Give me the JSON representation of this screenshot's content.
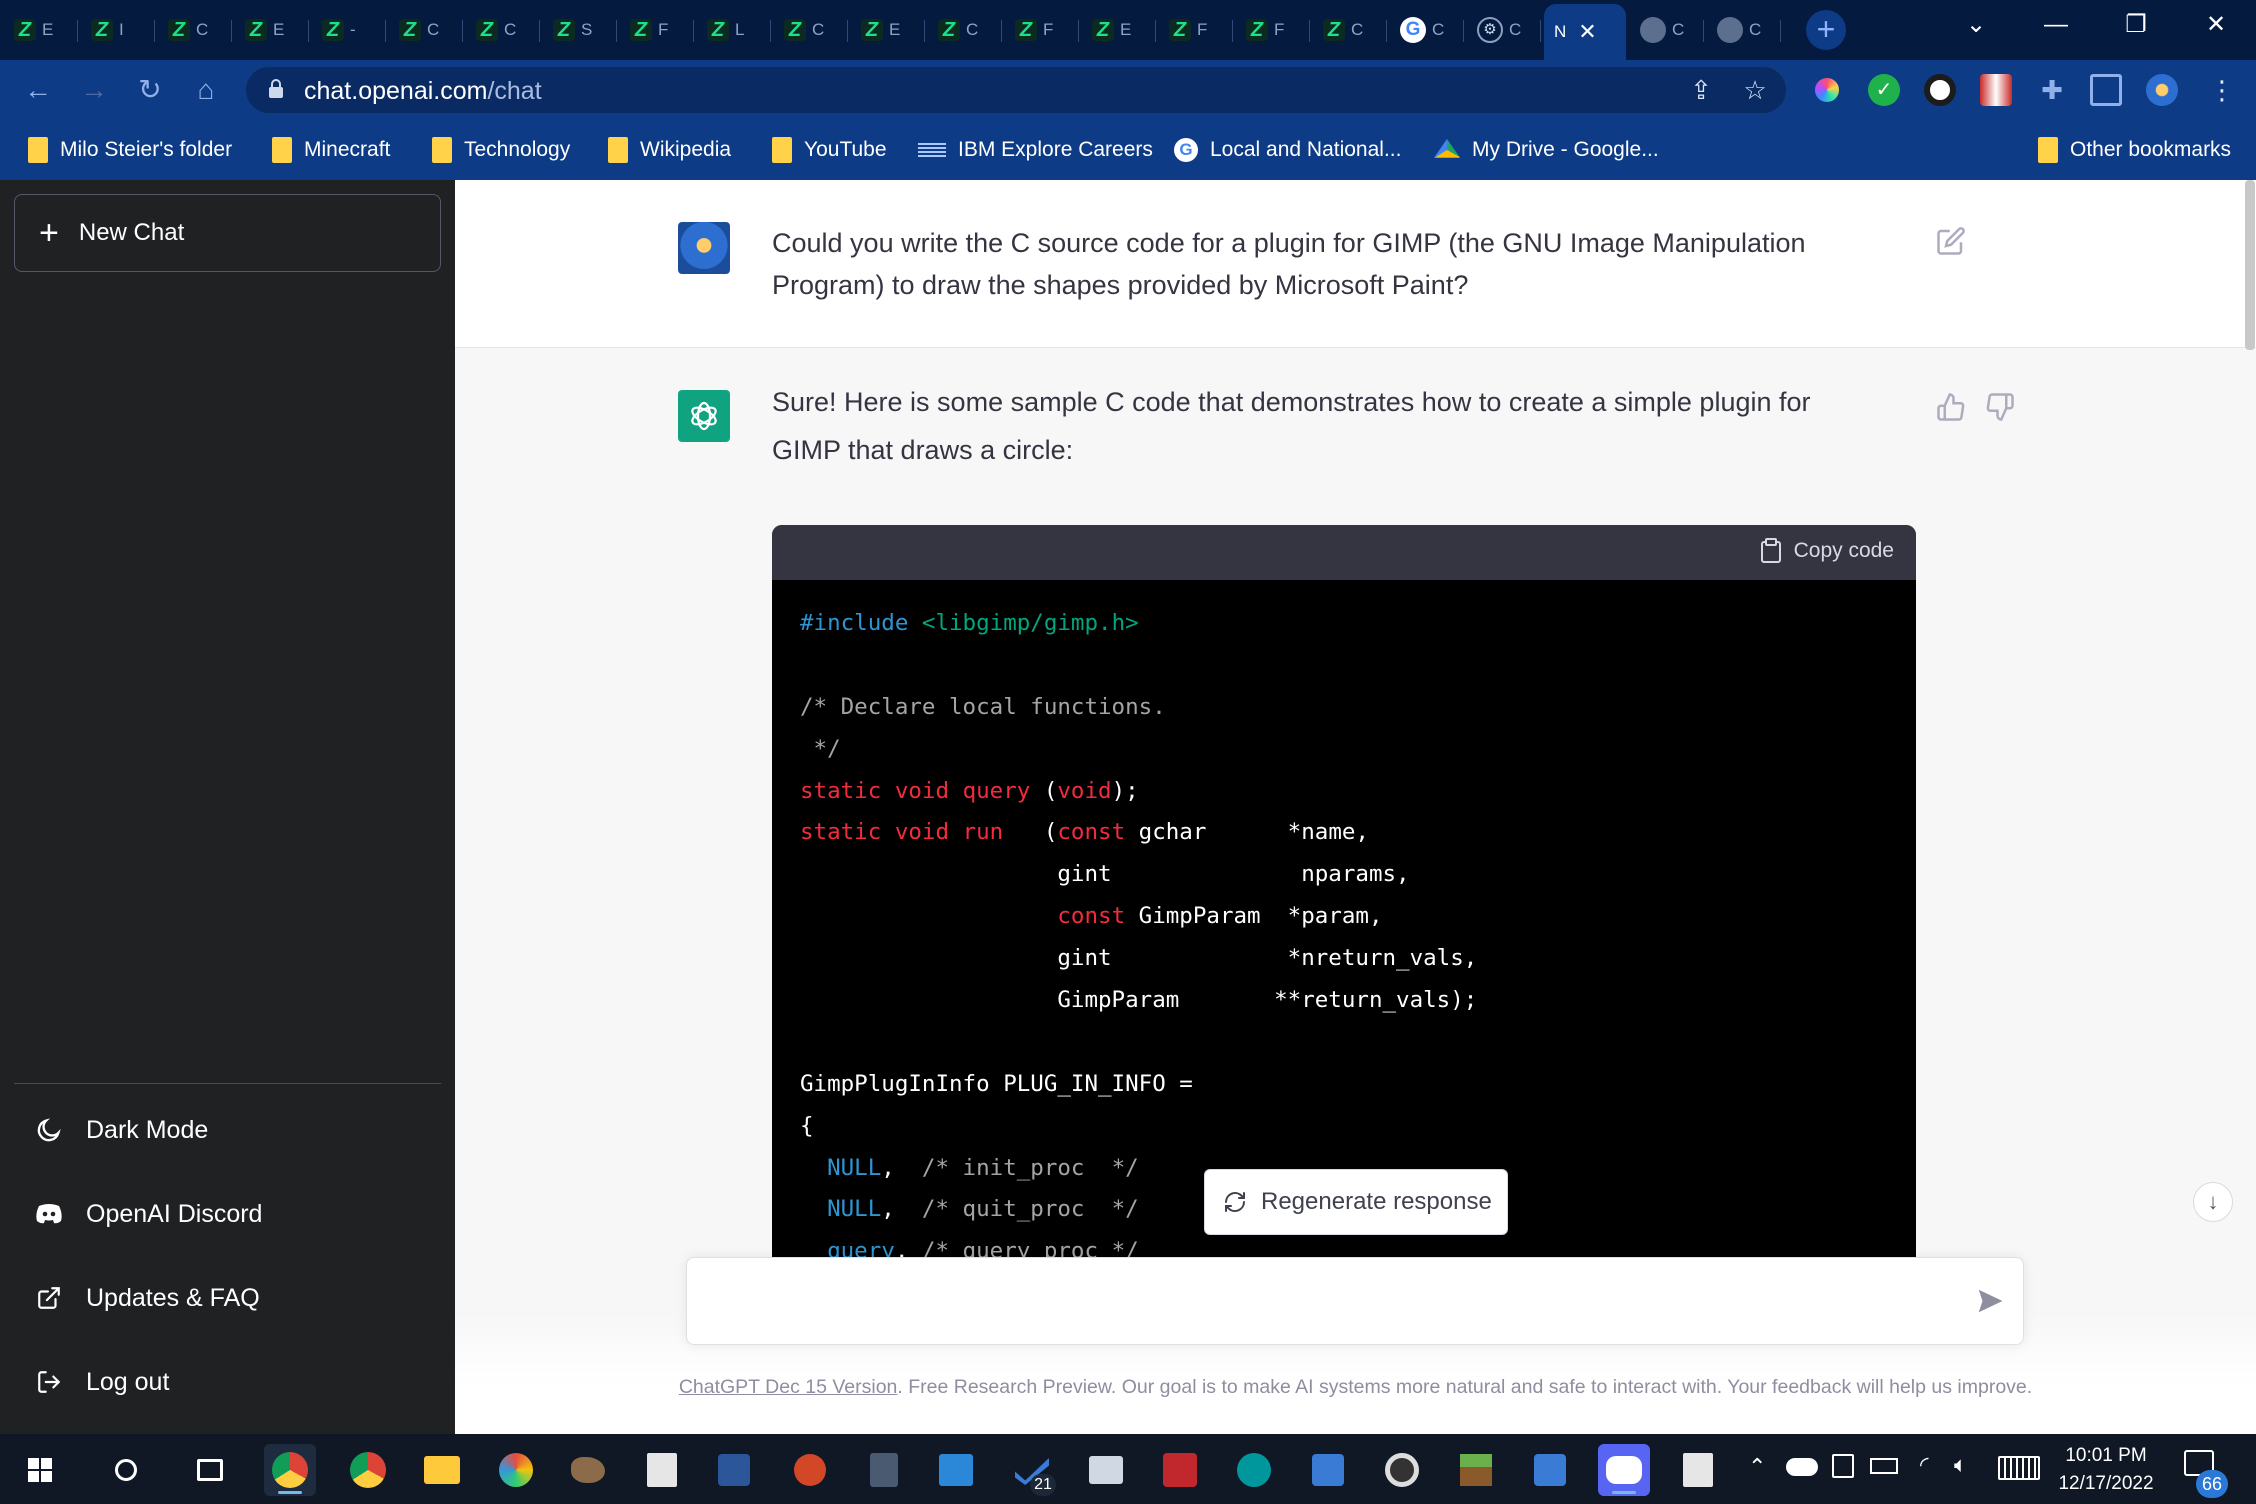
{
  "browser": {
    "tabs": [
      {
        "icon": "z-favicon",
        "letter": "E"
      },
      {
        "icon": "z-favicon",
        "letter": "I"
      },
      {
        "icon": "z-favicon",
        "letter": "C"
      },
      {
        "icon": "z-favicon",
        "letter": "E"
      },
      {
        "icon": "z-favicon",
        "letter": "-"
      },
      {
        "icon": "z-favicon",
        "letter": "C"
      },
      {
        "icon": "z-favicon",
        "letter": "C"
      },
      {
        "icon": "z-favicon",
        "letter": "S"
      },
      {
        "icon": "z-favicon",
        "letter": "F"
      },
      {
        "icon": "z-favicon",
        "letter": "L"
      },
      {
        "icon": "z-favicon",
        "letter": "C"
      },
      {
        "icon": "z-favicon",
        "letter": "E"
      },
      {
        "icon": "z-favicon",
        "letter": "C"
      },
      {
        "icon": "z-favicon",
        "letter": "F"
      },
      {
        "icon": "z-favicon",
        "letter": "E"
      },
      {
        "icon": "z-favicon",
        "letter": "F"
      },
      {
        "icon": "z-favicon",
        "letter": "F"
      },
      {
        "icon": "z-favicon",
        "letter": "C"
      },
      {
        "icon": "google-favicon",
        "letter": "C"
      },
      {
        "icon": "openai-favicon",
        "letter": "C"
      }
    ],
    "active_tab": {
      "letter": "N",
      "close": "✕"
    },
    "after_tabs": [
      {
        "icon": "globe-favicon",
        "letter": "C"
      },
      {
        "icon": "globe-favicon",
        "letter": "C"
      }
    ],
    "url_host": "chat.openai.com",
    "url_path": "/chat",
    "bookmarks": [
      {
        "label": "Milo Steier's folder",
        "icon": "folder"
      },
      {
        "label": "Minecraft",
        "icon": "folder"
      },
      {
        "label": "Technology",
        "icon": "folder"
      },
      {
        "label": "Wikipedia",
        "icon": "folder"
      },
      {
        "label": "YouTube",
        "icon": "folder"
      },
      {
        "label": "IBM Explore Careers",
        "icon": "ibm"
      },
      {
        "label": "Local and National...",
        "icon": "google"
      },
      {
        "label": "My Drive - Google...",
        "icon": "drive"
      }
    ],
    "other_bookmarks": "Other bookmarks"
  },
  "sidebar": {
    "new_chat": "New Chat",
    "items": [
      {
        "label": "Dark Mode",
        "icon": "moon-icon"
      },
      {
        "label": "OpenAI Discord",
        "icon": "discord-icon"
      },
      {
        "label": "Updates & FAQ",
        "icon": "external-link-icon"
      },
      {
        "label": "Log out",
        "icon": "logout-icon"
      }
    ]
  },
  "conversation": {
    "user_message": "Could you write the C source code for a plugin for GIMP (the GNU Image Manipulation Program) to draw the shapes provided by Microsoft Paint?",
    "assistant_message": "Sure! Here is some sample C code that demonstrates how to create a simple plugin for GIMP that draws a circle:",
    "copy_code": "Copy code",
    "code_lines": [
      [
        {
          "t": "d",
          "v": "#include"
        },
        {
          "t": "p",
          "v": " "
        },
        {
          "t": "s",
          "v": "<libgimp/gimp.h>"
        }
      ],
      [],
      [
        {
          "t": "c",
          "v": "/* Declare local functions."
        }
      ],
      [
        {
          "t": "c",
          "v": " */"
        }
      ],
      [
        {
          "t": "k",
          "v": "static"
        },
        {
          "t": "p",
          "v": " "
        },
        {
          "t": "k",
          "v": "void"
        },
        {
          "t": "p",
          "v": " "
        },
        {
          "t": "k",
          "v": "query"
        },
        {
          "t": "p",
          "v": " ("
        },
        {
          "t": "k",
          "v": "void"
        },
        {
          "t": "p",
          "v": ");"
        }
      ],
      [
        {
          "t": "k",
          "v": "static"
        },
        {
          "t": "p",
          "v": " "
        },
        {
          "t": "k",
          "v": "void"
        },
        {
          "t": "p",
          "v": " "
        },
        {
          "t": "k",
          "v": "run"
        },
        {
          "t": "p",
          "v": "   ("
        },
        {
          "t": "k",
          "v": "const"
        },
        {
          "t": "p",
          "v": " gchar      *name,"
        }
      ],
      [
        {
          "t": "p",
          "v": "                   gint              nparams,"
        }
      ],
      [
        {
          "t": "p",
          "v": "                   "
        },
        {
          "t": "k",
          "v": "const"
        },
        {
          "t": "p",
          "v": " GimpParam  *param,"
        }
      ],
      [
        {
          "t": "p",
          "v": "                   gint             *nreturn_vals,"
        }
      ],
      [
        {
          "t": "p",
          "v": "                   GimpParam       **return_vals);"
        }
      ],
      [],
      [
        {
          "t": "p",
          "v": "GimpPlugInInfo PLUG_IN_INFO ="
        }
      ],
      [
        {
          "t": "p",
          "v": "{"
        }
      ],
      [
        {
          "t": "p",
          "v": "  "
        },
        {
          "t": "d",
          "v": "NULL"
        },
        {
          "t": "p",
          "v": ",  "
        },
        {
          "t": "c",
          "v": "/* init_proc  */"
        }
      ],
      [
        {
          "t": "p",
          "v": "  "
        },
        {
          "t": "d",
          "v": "NULL"
        },
        {
          "t": "p",
          "v": ",  "
        },
        {
          "t": "c",
          "v": "/* quit_proc  */"
        }
      ],
      [
        {
          "t": "p",
          "v": "  "
        },
        {
          "t": "d",
          "v": "query"
        },
        {
          "t": "p",
          "v": ", "
        },
        {
          "t": "c",
          "v": "/* query_proc */"
        }
      ]
    ],
    "regenerate": "Regenerate response",
    "footer_link": "ChatGPT Dec 15 Version",
    "footer_text": ". Free Research Preview. Our goal is to make AI systems more natural and safe to interact with. Your feedback will help us improve."
  },
  "taskbar": {
    "time": "10:01 PM",
    "date": "12/17/2022",
    "notification_count": "66",
    "todo_badge": "21",
    "apps": [
      "windows-start-icon",
      "search-icon",
      "task-view-icon",
      "chrome-icon",
      "chrome-icon",
      "file-explorer-icon",
      "paint-icon",
      "gimp-icon",
      "notepad-icon",
      "word-icon",
      "powerpoint-icon",
      "calculator-icon",
      "calendar-icon",
      "todo-icon",
      "photos-icon",
      "devcpp-icon",
      "arduino-icon",
      "app-icon",
      "camera-icon",
      "minecraft-icon",
      "app-icon",
      "discord-icon",
      "notepad-icon"
    ]
  },
  "colors": {
    "tab_bg": "#041a3f",
    "toolbar_bg": "#0e3b85",
    "sidebar_bg": "#202123",
    "accent": "#10a37f",
    "code_keyword": "#f22c3d",
    "code_string": "#00a67d",
    "code_directive": "#2e95d3"
  }
}
